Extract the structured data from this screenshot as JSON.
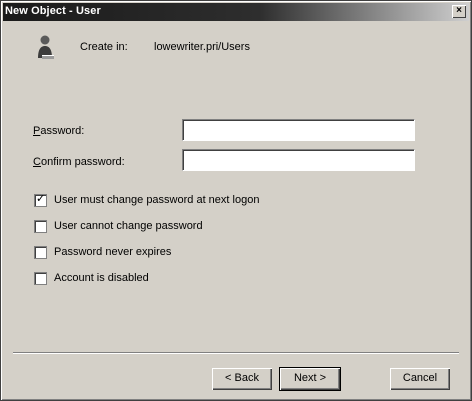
{
  "window": {
    "title": "New Object - User",
    "close_glyph": "×"
  },
  "header": {
    "icon": "user-icon",
    "create_in_label": "Create in:",
    "create_in_path": "lowewriter.pri/Users"
  },
  "form": {
    "password_label": "Password:",
    "password_mnemonic": "P",
    "password_rest": "assword:",
    "password_value": "",
    "confirm_label": "Confirm password:",
    "confirm_mnemonic": "C",
    "confirm_rest": "onfirm password:",
    "confirm_value": ""
  },
  "options": [
    {
      "label": "User must change password at next logon",
      "checked": true
    },
    {
      "label": "User cannot change password",
      "checked": false
    },
    {
      "label": "Password never expires",
      "checked": false
    },
    {
      "label": "Account is disabled",
      "checked": false
    }
  ],
  "buttons": {
    "back": "< Back",
    "next": "Next >",
    "cancel": "Cancel"
  }
}
